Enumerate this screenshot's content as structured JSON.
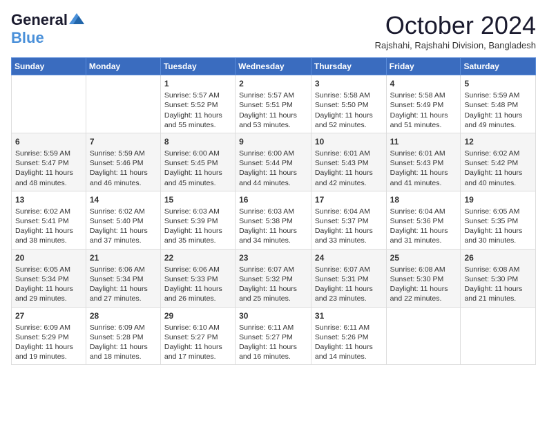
{
  "logo": {
    "line1": "General",
    "line2": "Blue"
  },
  "title": "October 2024",
  "location": "Rajshahi, Rajshahi Division, Bangladesh",
  "days_header": [
    "Sunday",
    "Monday",
    "Tuesday",
    "Wednesday",
    "Thursday",
    "Friday",
    "Saturday"
  ],
  "weeks": [
    [
      {
        "day": "",
        "info": ""
      },
      {
        "day": "",
        "info": ""
      },
      {
        "day": "1",
        "info": "Sunrise: 5:57 AM\nSunset: 5:52 PM\nDaylight: 11 hours and 55 minutes."
      },
      {
        "day": "2",
        "info": "Sunrise: 5:57 AM\nSunset: 5:51 PM\nDaylight: 11 hours and 53 minutes."
      },
      {
        "day": "3",
        "info": "Sunrise: 5:58 AM\nSunset: 5:50 PM\nDaylight: 11 hours and 52 minutes."
      },
      {
        "day": "4",
        "info": "Sunrise: 5:58 AM\nSunset: 5:49 PM\nDaylight: 11 hours and 51 minutes."
      },
      {
        "day": "5",
        "info": "Sunrise: 5:59 AM\nSunset: 5:48 PM\nDaylight: 11 hours and 49 minutes."
      }
    ],
    [
      {
        "day": "6",
        "info": "Sunrise: 5:59 AM\nSunset: 5:47 PM\nDaylight: 11 hours and 48 minutes."
      },
      {
        "day": "7",
        "info": "Sunrise: 5:59 AM\nSunset: 5:46 PM\nDaylight: 11 hours and 46 minutes."
      },
      {
        "day": "8",
        "info": "Sunrise: 6:00 AM\nSunset: 5:45 PM\nDaylight: 11 hours and 45 minutes."
      },
      {
        "day": "9",
        "info": "Sunrise: 6:00 AM\nSunset: 5:44 PM\nDaylight: 11 hours and 44 minutes."
      },
      {
        "day": "10",
        "info": "Sunrise: 6:01 AM\nSunset: 5:43 PM\nDaylight: 11 hours and 42 minutes."
      },
      {
        "day": "11",
        "info": "Sunrise: 6:01 AM\nSunset: 5:43 PM\nDaylight: 11 hours and 41 minutes."
      },
      {
        "day": "12",
        "info": "Sunrise: 6:02 AM\nSunset: 5:42 PM\nDaylight: 11 hours and 40 minutes."
      }
    ],
    [
      {
        "day": "13",
        "info": "Sunrise: 6:02 AM\nSunset: 5:41 PM\nDaylight: 11 hours and 38 minutes."
      },
      {
        "day": "14",
        "info": "Sunrise: 6:02 AM\nSunset: 5:40 PM\nDaylight: 11 hours and 37 minutes."
      },
      {
        "day": "15",
        "info": "Sunrise: 6:03 AM\nSunset: 5:39 PM\nDaylight: 11 hours and 35 minutes."
      },
      {
        "day": "16",
        "info": "Sunrise: 6:03 AM\nSunset: 5:38 PM\nDaylight: 11 hours and 34 minutes."
      },
      {
        "day": "17",
        "info": "Sunrise: 6:04 AM\nSunset: 5:37 PM\nDaylight: 11 hours and 33 minutes."
      },
      {
        "day": "18",
        "info": "Sunrise: 6:04 AM\nSunset: 5:36 PM\nDaylight: 11 hours and 31 minutes."
      },
      {
        "day": "19",
        "info": "Sunrise: 6:05 AM\nSunset: 5:35 PM\nDaylight: 11 hours and 30 minutes."
      }
    ],
    [
      {
        "day": "20",
        "info": "Sunrise: 6:05 AM\nSunset: 5:34 PM\nDaylight: 11 hours and 29 minutes."
      },
      {
        "day": "21",
        "info": "Sunrise: 6:06 AM\nSunset: 5:34 PM\nDaylight: 11 hours and 27 minutes."
      },
      {
        "day": "22",
        "info": "Sunrise: 6:06 AM\nSunset: 5:33 PM\nDaylight: 11 hours and 26 minutes."
      },
      {
        "day": "23",
        "info": "Sunrise: 6:07 AM\nSunset: 5:32 PM\nDaylight: 11 hours and 25 minutes."
      },
      {
        "day": "24",
        "info": "Sunrise: 6:07 AM\nSunset: 5:31 PM\nDaylight: 11 hours and 23 minutes."
      },
      {
        "day": "25",
        "info": "Sunrise: 6:08 AM\nSunset: 5:30 PM\nDaylight: 11 hours and 22 minutes."
      },
      {
        "day": "26",
        "info": "Sunrise: 6:08 AM\nSunset: 5:30 PM\nDaylight: 11 hours and 21 minutes."
      }
    ],
    [
      {
        "day": "27",
        "info": "Sunrise: 6:09 AM\nSunset: 5:29 PM\nDaylight: 11 hours and 19 minutes."
      },
      {
        "day": "28",
        "info": "Sunrise: 6:09 AM\nSunset: 5:28 PM\nDaylight: 11 hours and 18 minutes."
      },
      {
        "day": "29",
        "info": "Sunrise: 6:10 AM\nSunset: 5:27 PM\nDaylight: 11 hours and 17 minutes."
      },
      {
        "day": "30",
        "info": "Sunrise: 6:11 AM\nSunset: 5:27 PM\nDaylight: 11 hours and 16 minutes."
      },
      {
        "day": "31",
        "info": "Sunrise: 6:11 AM\nSunset: 5:26 PM\nDaylight: 11 hours and 14 minutes."
      },
      {
        "day": "",
        "info": ""
      },
      {
        "day": "",
        "info": ""
      }
    ]
  ]
}
